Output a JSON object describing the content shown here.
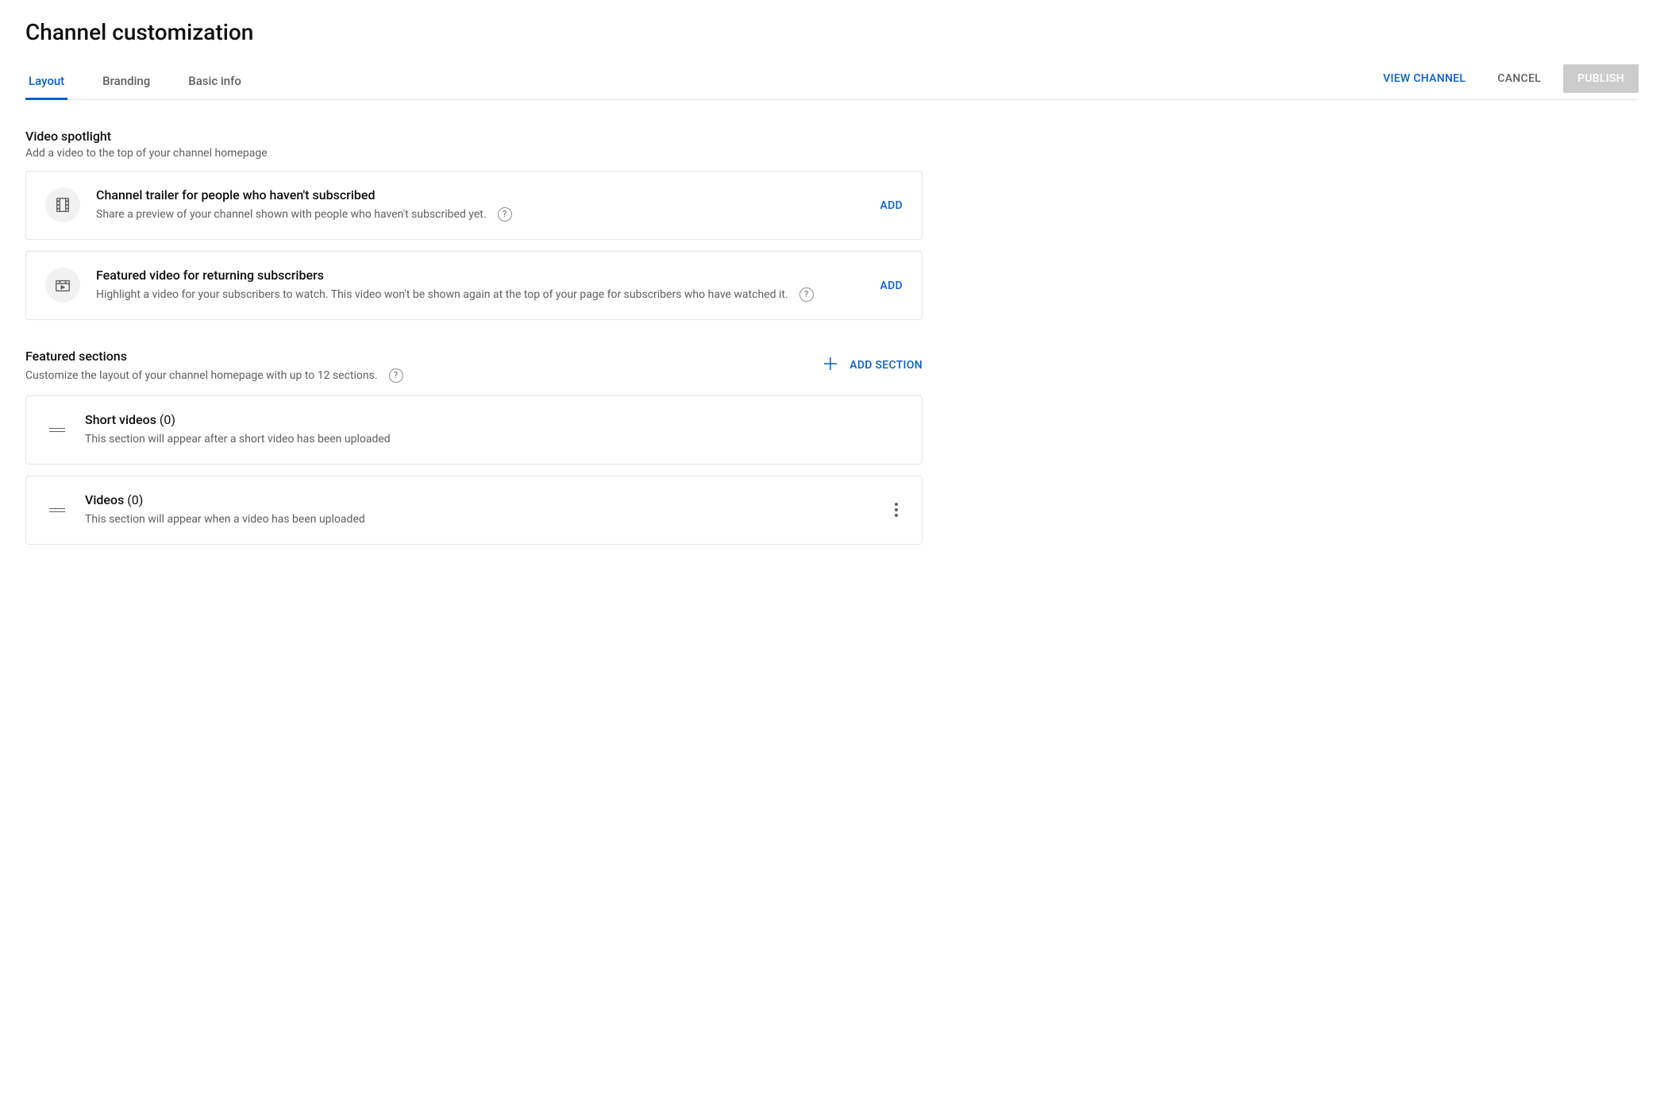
{
  "pageTitle": "Channel customization",
  "tabs": [
    "Layout",
    "Branding",
    "Basic info"
  ],
  "activeTab": 0,
  "actions": {
    "view": "VIEW CHANNEL",
    "cancel": "CANCEL",
    "publish": "PUBLISH"
  },
  "spotlight": {
    "title": "Video spotlight",
    "subtitle": "Add a video to the top of your channel homepage",
    "items": [
      {
        "title": "Channel trailer for people who haven't subscribed",
        "desc": "Share a preview of your channel shown with people who haven't subscribed yet.",
        "action": "ADD"
      },
      {
        "title": "Featured video for returning subscribers",
        "desc": "Highlight a video for your subscribers to watch. This video won't be shown again at the top of your page for subscribers who have watched it.",
        "action": "ADD"
      }
    ]
  },
  "featured": {
    "title": "Featured sections",
    "subtitle": "Customize the layout of your channel homepage with up to 12 sections.",
    "addLabel": "ADD SECTION",
    "items": [
      {
        "title": "Short videos",
        "count": "(0)",
        "desc": "This section will appear after a short video has been uploaded",
        "hasMenu": false
      },
      {
        "title": "Videos",
        "count": "(0)",
        "desc": "This section will appear when a video has been uploaded",
        "hasMenu": true
      }
    ]
  }
}
